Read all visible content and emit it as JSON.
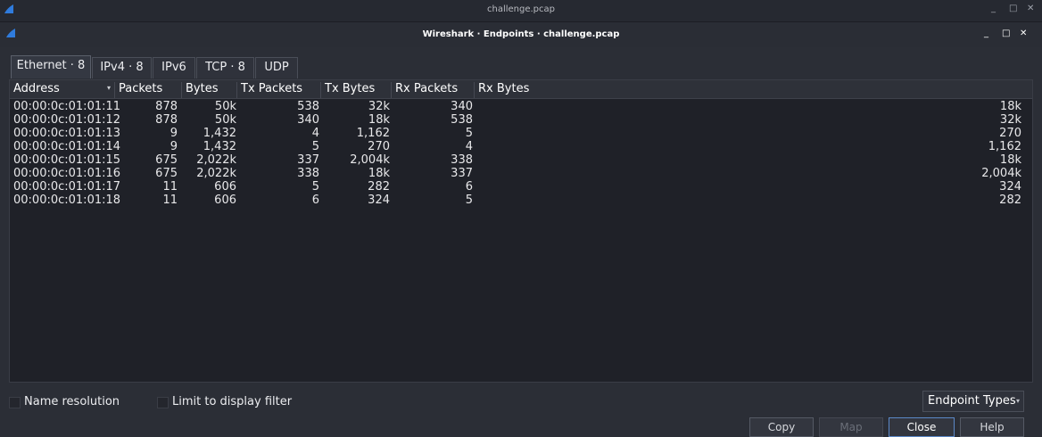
{
  "window": {
    "outer_title": "challenge.pcap",
    "inner_title": "Wireshark · Endpoints · challenge.pcap",
    "controls": {
      "minimize": "_",
      "maximize": "□",
      "close": "✕"
    }
  },
  "tabs": [
    {
      "label": "Ethernet · 8",
      "active": true
    },
    {
      "label": "IPv4 · 8",
      "active": false
    },
    {
      "label": "IPv6",
      "active": false
    },
    {
      "label": "TCP · 8",
      "active": false
    },
    {
      "label": "UDP",
      "active": false
    }
  ],
  "table": {
    "columns": [
      "Address",
      "Packets",
      "Bytes",
      "Tx Packets",
      "Tx Bytes",
      "Rx Packets",
      "Rx Bytes"
    ],
    "sort_indicator": "▾",
    "rows": [
      [
        "00:00:0c:01:01:11",
        "878",
        "50k",
        "538",
        "32k",
        "340",
        "18k"
      ],
      [
        "00:00:0c:01:01:12",
        "878",
        "50k",
        "340",
        "18k",
        "538",
        "32k"
      ],
      [
        "00:00:0c:01:01:13",
        "9",
        "1,432",
        "4",
        "1,162",
        "5",
        "270"
      ],
      [
        "00:00:0c:01:01:14",
        "9",
        "1,432",
        "5",
        "270",
        "4",
        "1,162"
      ],
      [
        "00:00:0c:01:01:15",
        "675",
        "2,022k",
        "337",
        "2,004k",
        "338",
        "18k"
      ],
      [
        "00:00:0c:01:01:16",
        "675",
        "2,022k",
        "338",
        "18k",
        "337",
        "2,004k"
      ],
      [
        "00:00:0c:01:01:17",
        "11",
        "606",
        "5",
        "282",
        "6",
        "324"
      ],
      [
        "00:00:0c:01:01:18",
        "11",
        "606",
        "6",
        "324",
        "5",
        "282"
      ]
    ]
  },
  "options": {
    "name_resolution": "Name resolution",
    "limit_filter": "Limit to display filter",
    "endpoint_types": "Endpoint Types",
    "dropdown_arrow": "▾"
  },
  "buttons": {
    "copy": "Copy",
    "map": "Map",
    "close": "Close",
    "help": "Help"
  }
}
